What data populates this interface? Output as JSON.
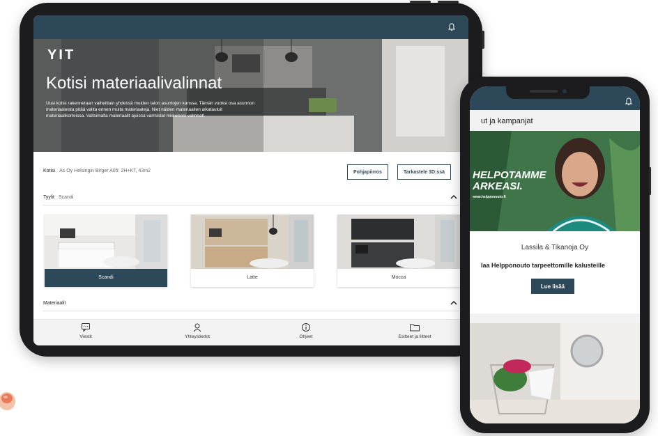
{
  "tablet": {
    "hero": {
      "logo": "YIT",
      "title": "Kotisi materiaalivalinnat",
      "description": "Uusi kotisi rakennetaan vaiheittain yhdessä muiden talon asuntojen kanssa. Tämän vuoksi osa asunnon materiaaleista pitää valita ennen muita materiaaleja. Niet näiden materiaalien aikatauluit materiaalikorteissa. Valtsimalla materiaalit ajoissa varmistat mieleisesi valinnat!"
    },
    "home": {
      "label": "Kotisi",
      "address": "As Oy Helsingin Birger A05: 2H+KT, 43m2"
    },
    "buttons": {
      "floorplan": "Pohjapiirros",
      "view3d": "Tarkastele 3D:ssä"
    },
    "styles": {
      "label": "Tyylit",
      "selected": "Scandi",
      "cards": [
        {
          "label": "Scandi"
        },
        {
          "label": "Latte"
        },
        {
          "label": "Mocca"
        }
      ]
    },
    "materials": {
      "label": "Materiaalit"
    },
    "nav": [
      {
        "label": "Viestit",
        "icon": "message-icon"
      },
      {
        "label": "Yhteystiedot",
        "icon": "contact-icon"
      },
      {
        "label": "Ohjeet",
        "icon": "info-icon"
      },
      {
        "label": "Esitteet ja liitteet",
        "icon": "folder-icon"
      }
    ]
  },
  "phone": {
    "header": "ut ja kampanjat",
    "promo": {
      "headline_1": "HELPOTAMME",
      "headline_2": "ARKEASI.",
      "url": "www.helpponouto.fi"
    },
    "company": "Lassila & Tikanoja Oy",
    "tagline": "laa Helpponouto tarpeettomille kalusteille",
    "button": "Lue lisää"
  },
  "colors": {
    "primary": "#2d4858",
    "accent_green": "#4f8a5a"
  }
}
